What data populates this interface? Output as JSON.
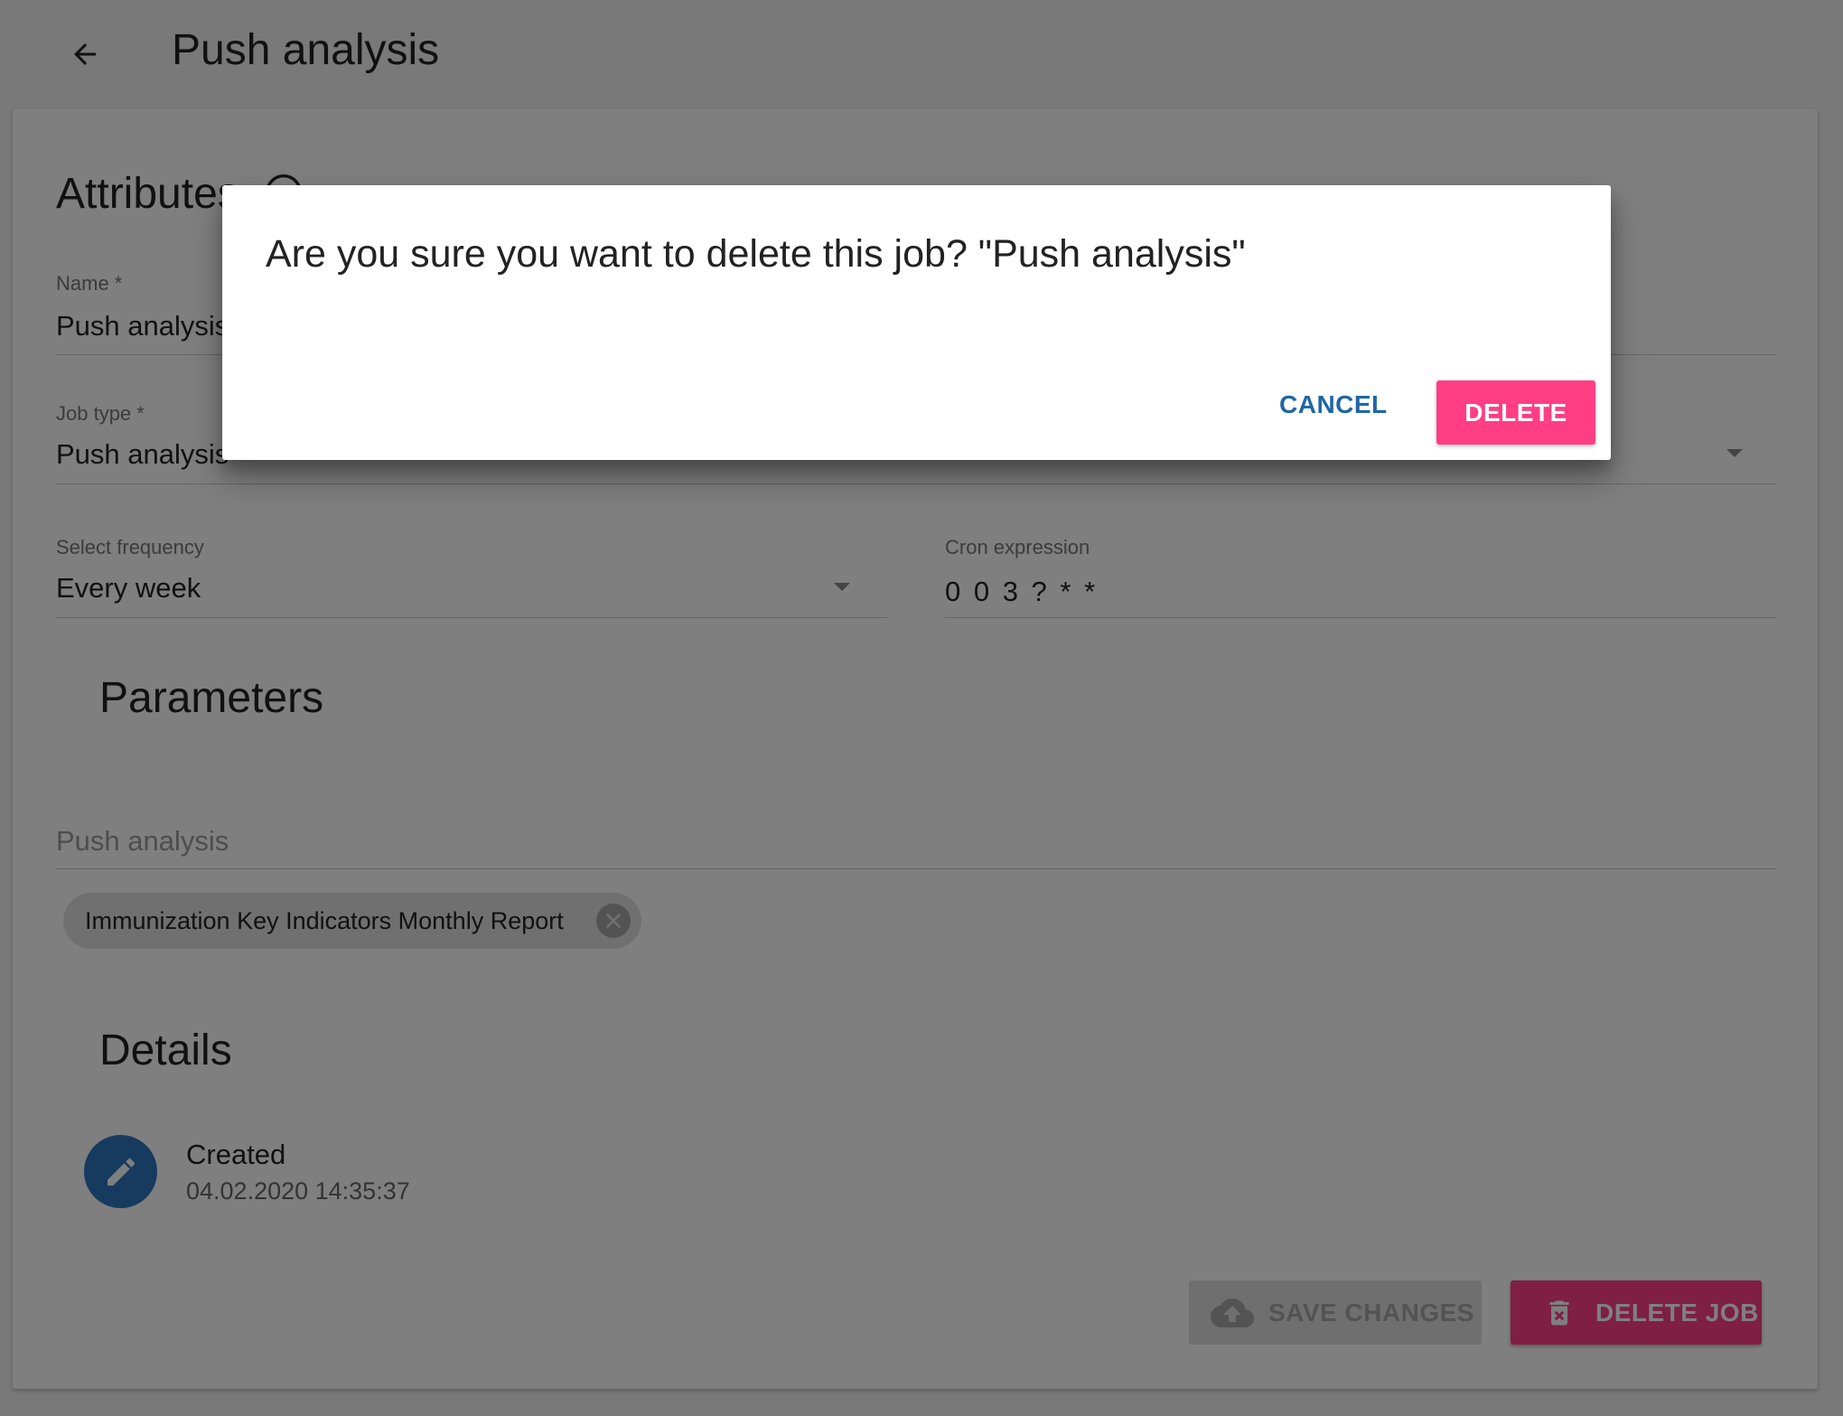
{
  "header": {
    "title": "Push analysis"
  },
  "attributes": {
    "title": "Attributes",
    "name": {
      "label": "Name *",
      "value": "Push analysis"
    },
    "job_type": {
      "label": "Job type *",
      "value": "Push analysis"
    },
    "frequency": {
      "label": "Select frequency",
      "value": "Every week"
    },
    "cron": {
      "label": "Cron expression",
      "value": "0 0 3 ? * *"
    }
  },
  "parameters": {
    "title": "Parameters",
    "push_analysis_placeholder": "Push analysis",
    "chips": [
      "Immunization Key Indicators Monthly Report"
    ]
  },
  "details": {
    "title": "Details",
    "created_label": "Created",
    "created_value": "04.02.2020 14:35:37"
  },
  "actions": {
    "save_label": "SAVE CHANGES",
    "delete_label": "DELETE JOB"
  },
  "dialog": {
    "message": "Are you sure you want to delete this job? \"Push analysis\"",
    "cancel_label": "CANCEL",
    "delete_label": "DELETE"
  },
  "colors": {
    "primary": "#1f66a6",
    "accent": "#ff3e84",
    "avatar": "#2c77be"
  },
  "icons": [
    "arrow-back-icon",
    "help-circle-icon",
    "dropdown-caret-icon",
    "chip-remove-icon",
    "pencil-icon",
    "cloud-upload-icon",
    "trash-icon"
  ]
}
